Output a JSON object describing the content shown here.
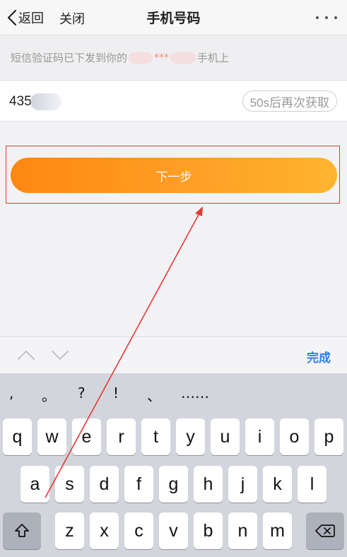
{
  "nav": {
    "back_label": "返回",
    "close_label": "关闭",
    "title": "手机号码"
  },
  "hint": {
    "prefix": "短信验证码已下发到你的",
    "masked_stars": "***",
    "suffix": "手机上"
  },
  "code": {
    "value": "435",
    "resend_label": "50s后再次获取"
  },
  "next_button": {
    "label": "下一步"
  },
  "accessory": {
    "done_label": "完成"
  },
  "keyboard": {
    "punctuation": [
      ",",
      "。",
      "?",
      "!",
      "、",
      "……"
    ],
    "row1": [
      "q",
      "w",
      "e",
      "r",
      "t",
      "y",
      "u",
      "i",
      "o",
      "p"
    ],
    "row2": [
      "a",
      "s",
      "d",
      "f",
      "g",
      "h",
      "j",
      "k",
      "l"
    ],
    "row3": [
      "z",
      "x",
      "c",
      "v",
      "b",
      "n",
      "m"
    ]
  },
  "colors": {
    "accent_orange_start": "#ff8712",
    "accent_orange_end": "#ffb430",
    "done_blue": "#2c7ff0",
    "annotation_red": "#e53a35"
  }
}
